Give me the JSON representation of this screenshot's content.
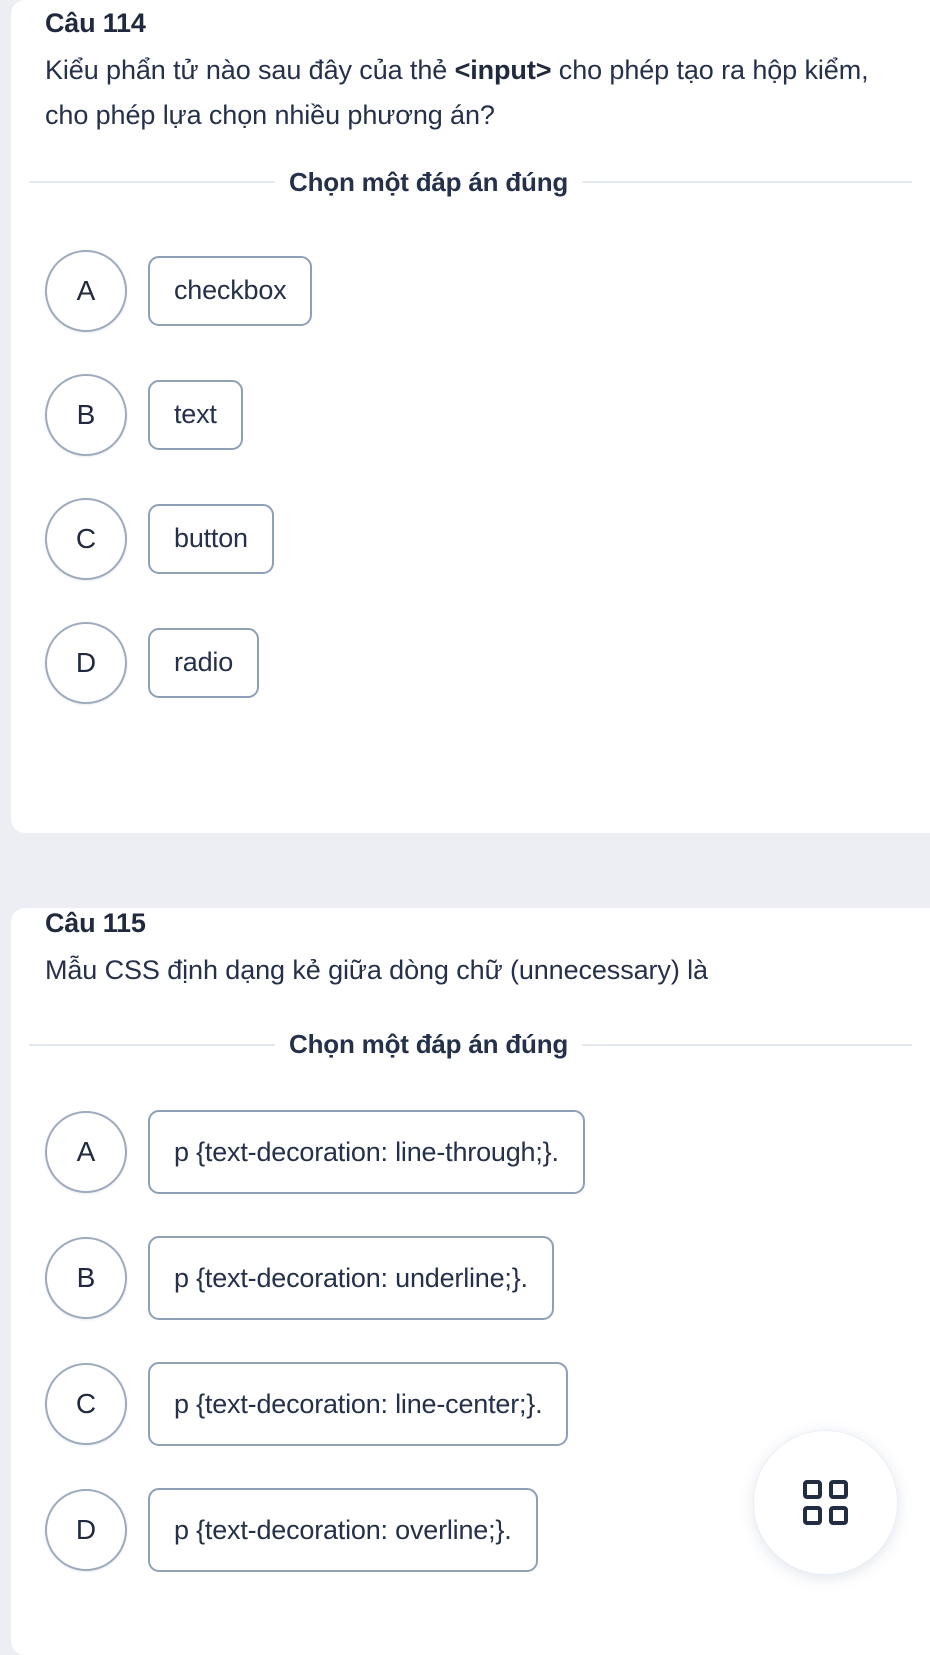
{
  "theme": {
    "page_background": "#eceef3",
    "card_background": "#ffffff",
    "text_color": "#25314a",
    "heading_color": "#20293d",
    "option_border": "#8e9fb8",
    "circle_border": "#9eaabd",
    "divider_color": "#e4e8f0",
    "icon_color": "#222d43"
  },
  "questions": [
    {
      "title": "Câu 114",
      "prompt_before": "Kiểu phẩn tử nào sau đây của thẻ ",
      "prompt_bold": "<input>",
      "prompt_after": " cho phép tạo ra hộp kiểm, cho phép lựa chọn nhiều phương án?",
      "choose_label": "Chọn một đáp án đúng",
      "options": [
        {
          "letter": "A",
          "text": "checkbox"
        },
        {
          "letter": "B",
          "text": "text"
        },
        {
          "letter": "C",
          "text": "button"
        },
        {
          "letter": "D",
          "text": "radio"
        }
      ]
    },
    {
      "title": "Câu 115",
      "prompt_before": "Mẫu CSS định dạng kẻ giữa dòng chữ (unnecessary) là",
      "prompt_bold": "",
      "prompt_after": "",
      "choose_label": "Chọn một đáp án đúng",
      "options": [
        {
          "letter": "A",
          "text": "p {text-decoration: line-through;}."
        },
        {
          "letter": "B",
          "text": "p {text-decoration: underline;}."
        },
        {
          "letter": "C",
          "text": "p {text-decoration: line-center;}."
        },
        {
          "letter": "D",
          "text": "p {text-decoration: overline;}."
        }
      ]
    }
  ],
  "fab": {
    "icon": "grid-2x2-icon",
    "label": ""
  }
}
